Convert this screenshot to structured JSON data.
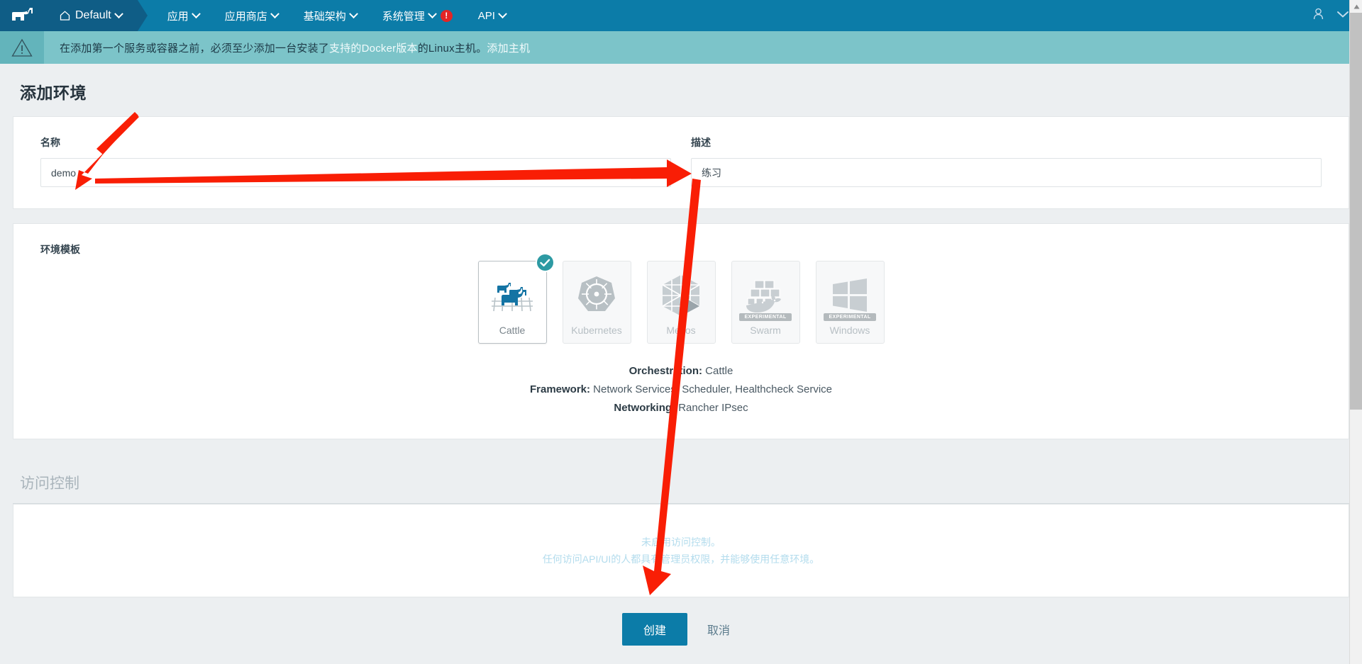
{
  "navbar": {
    "logo_icon": "rancher-cow-logo",
    "environment": {
      "label": "Default",
      "icon": "home-icon"
    },
    "items": [
      {
        "label": "应用",
        "icon": "chevron-down-icon",
        "alert": false
      },
      {
        "label": "应用商店",
        "icon": "chevron-down-icon",
        "alert": false
      },
      {
        "label": "基础架构",
        "icon": "chevron-down-icon",
        "alert": false
      },
      {
        "label": "系统管理",
        "icon": "chevron-down-icon",
        "alert": true,
        "alert_badge": "!"
      },
      {
        "label": "API",
        "icon": "chevron-down-icon",
        "alert": false
      }
    ],
    "user_icon": "user-avatar-icon",
    "user_caret_icon": "chevron-down-icon"
  },
  "notice": {
    "icon": "warning-triangle-icon",
    "text_before": "在添加第一个服务或容器之前，必须至少添加一台安装了",
    "link_docker": "支持的Docker版本",
    "text_middle": " 的Linux主机。",
    "link_addhost": "添加主机"
  },
  "page": {
    "title": "添加环境"
  },
  "form": {
    "name": {
      "label": "名称",
      "value": "demo",
      "placeholder": ""
    },
    "description": {
      "label": "描述",
      "value": "练习",
      "placeholder": ""
    }
  },
  "templates": {
    "section_label": "环境模板",
    "items": [
      {
        "name": "Cattle",
        "icon": "cattle-icon",
        "selected": true,
        "experimental": false,
        "check_icon": "check-circle-icon"
      },
      {
        "name": "Kubernetes",
        "icon": "kubernetes-helm-icon",
        "selected": false,
        "experimental": false
      },
      {
        "name": "Mesos",
        "icon": "mesos-icon",
        "selected": false,
        "experimental": false
      },
      {
        "name": "Swarm",
        "icon": "docker-swarm-icon",
        "selected": false,
        "experimental": true,
        "exp_label": "EXPERIMENTAL"
      },
      {
        "name": "Windows",
        "icon": "windows-icon",
        "selected": false,
        "experimental": true,
        "exp_label": "EXPERIMENTAL"
      }
    ],
    "info": {
      "orchestration_label": "Orchestration:",
      "orchestration_value": " Cattle",
      "framework_label": "Framework:",
      "framework_value": " Network Services, Scheduler, Healthcheck Service",
      "networking_label": "Networking:",
      "networking_value": " Rancher IPsec"
    }
  },
  "access_control": {
    "title": "访问控制",
    "line1": "未启用访问控制。",
    "line2": "任何访问API/UI的人都具有管理员权限，并能够使用任意环境。"
  },
  "footer": {
    "create_label": "创建",
    "cancel_label": "取消"
  },
  "colors": {
    "brand_blue": "#0c7ca8",
    "brand_blue_dark": "#0f5d86",
    "notice_teal": "#7cc4c9",
    "check_teal": "#2d9aa3",
    "alert_red": "#e32525",
    "annotation_red": "#f91e05",
    "page_bg": "#eceff1"
  },
  "annotations": {
    "arrow_name_field": "red-arrow-pointing-to-name-input",
    "arrow_description_field": "red-arrow-pointing-to-description-input",
    "arrow_create_button": "red-arrow-pointing-to-create-button"
  },
  "scrollbar": {
    "up_arrow_icon": "scroll-up-arrow-icon"
  }
}
